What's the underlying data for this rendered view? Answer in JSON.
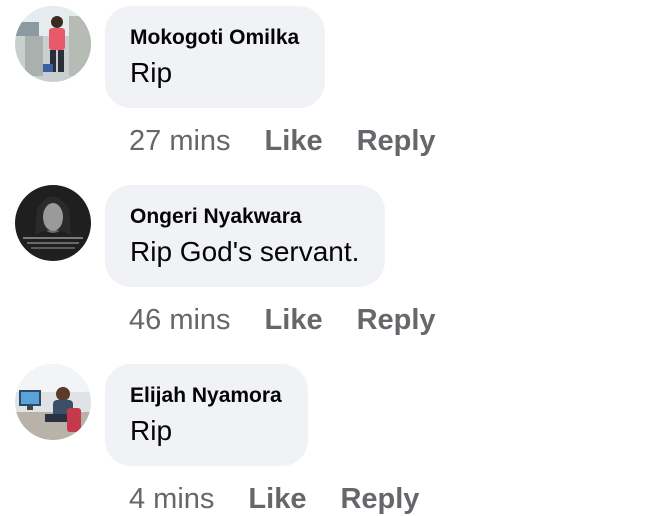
{
  "comments": [
    {
      "author": "Mokogoti Omilka",
      "text": "Rip",
      "time": "27 mins",
      "like_label": "Like",
      "reply_label": "Reply",
      "avatar_icon": "profile-photo-standing-person"
    },
    {
      "author": "Ongeri Nyakwara",
      "text": "Rip God's servant.",
      "time": "46 mins",
      "like_label": "Like",
      "reply_label": "Reply",
      "avatar_icon": "profile-photo-portrait"
    },
    {
      "author": "Elijah Nyamora",
      "text": "Rip",
      "time": "4 mins",
      "like_label": "Like",
      "reply_label": "Reply",
      "avatar_icon": "profile-photo-desk-computer"
    }
  ],
  "colors": {
    "bubble": "#f0f2f5",
    "name": "#050505",
    "meta": "#65676b"
  }
}
